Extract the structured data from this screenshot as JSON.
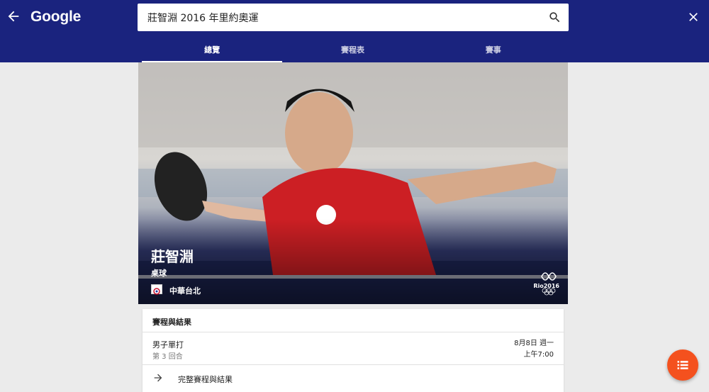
{
  "header": {
    "logo": "Google",
    "search_value": "莊智淵 2016 年里約奧運",
    "tabs": [
      {
        "label": "總覽",
        "active": true
      },
      {
        "label": "賽程表",
        "active": false
      },
      {
        "label": "賽事",
        "active": false
      }
    ]
  },
  "hero": {
    "name": "莊智淵",
    "sport": "桌球",
    "country": "中華台北",
    "badge_text": "Rio2016"
  },
  "results_card": {
    "title": "賽程與結果",
    "event_name": "男子單打",
    "event_round": "第 3 回合",
    "event_date": "8月8日 週一",
    "event_time": "上午7:00",
    "more_label": "完整賽程與結果"
  },
  "colors": {
    "header_bg": "#1a237e",
    "fab": "#f4511e",
    "page_bg": "#ebebeb"
  },
  "icons": [
    "arrow-left-icon",
    "search-icon",
    "close-icon",
    "arrow-right-icon",
    "list-icon"
  ]
}
